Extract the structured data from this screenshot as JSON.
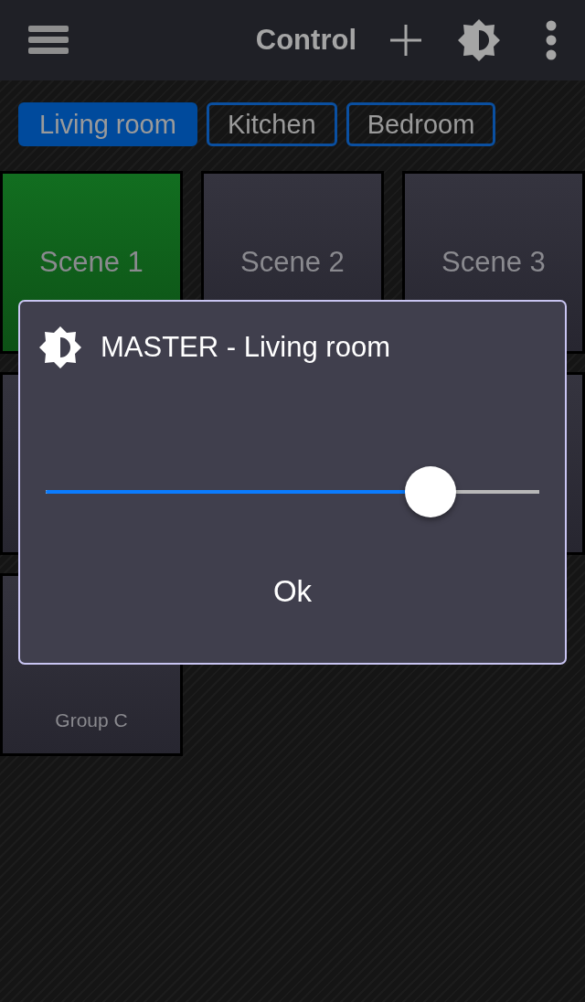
{
  "header": {
    "title": "Control"
  },
  "room_tabs": [
    {
      "label": "Living room",
      "selected": true
    },
    {
      "label": "Kitchen",
      "selected": false
    },
    {
      "label": "Bedroom",
      "selected": false
    }
  ],
  "tiles": [
    {
      "kind": "scene",
      "name": "Scene 1",
      "active": true
    },
    {
      "kind": "scene",
      "name": "Scene 2",
      "active": false
    },
    {
      "kind": "scene",
      "name": "Scene 3",
      "active": false
    },
    {
      "kind": "blank",
      "active": false
    },
    {
      "kind": "covered"
    },
    {
      "kind": "blank",
      "active": false
    },
    {
      "kind": "group",
      "group": "Group C",
      "active": false
    }
  ],
  "dialog": {
    "title": "MASTER - Living room",
    "slider": {
      "level": 0.78
    },
    "button": "Ok"
  }
}
